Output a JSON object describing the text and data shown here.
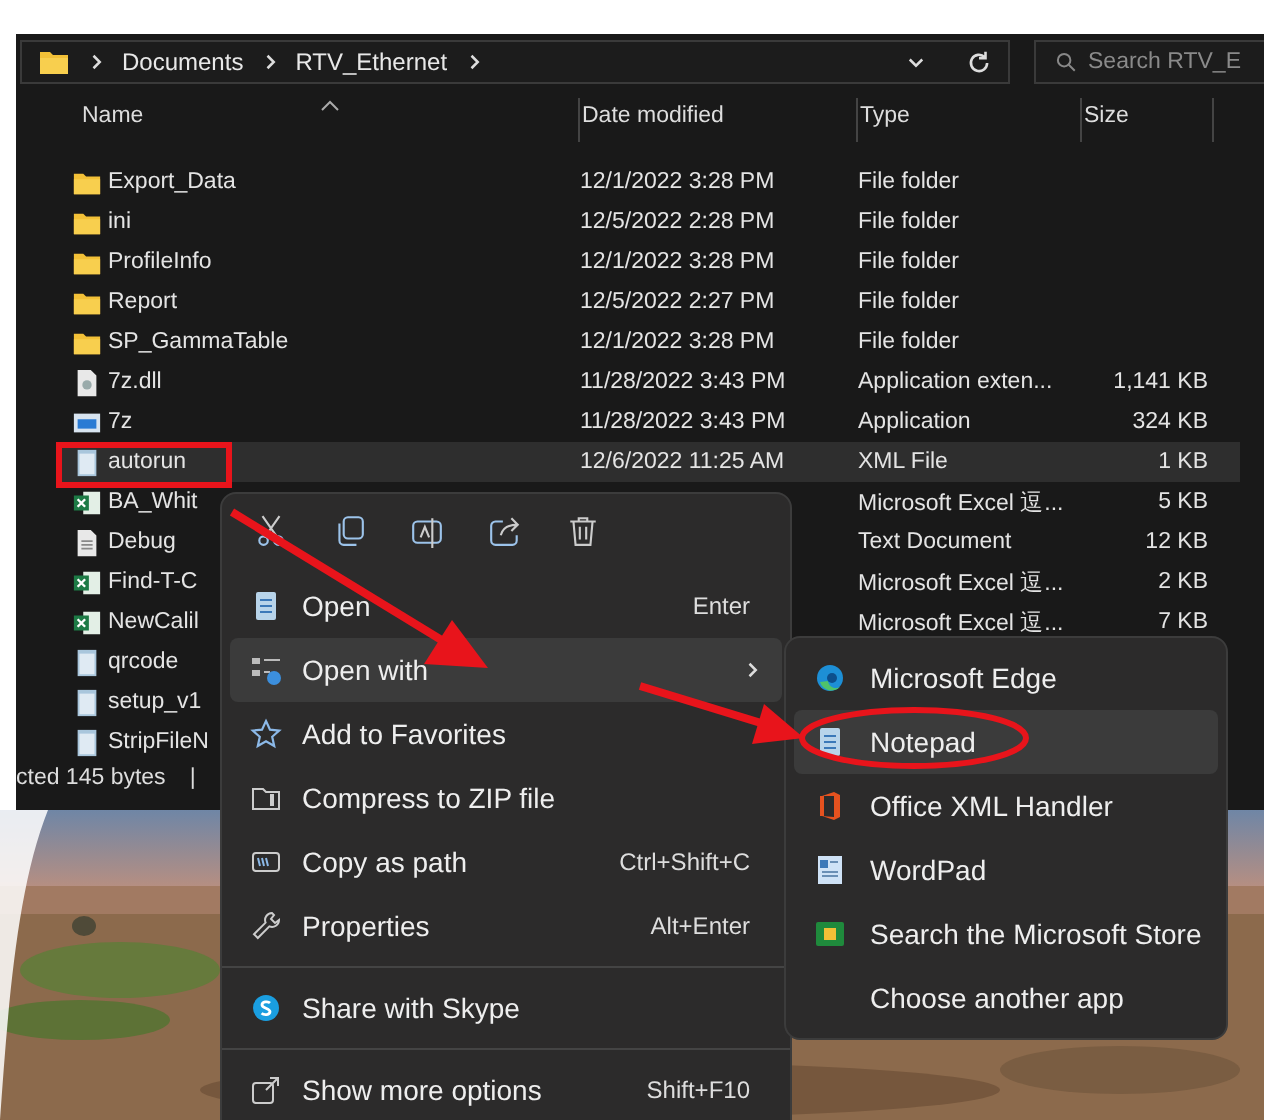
{
  "address_bar": {
    "path": [
      "Documents",
      "RTV_Ethernet"
    ]
  },
  "search": {
    "placeholder": "Search RTV_E"
  },
  "columns": [
    "Name",
    "Date modified",
    "Type",
    "Size"
  ],
  "rows": [
    {
      "kind": "folder",
      "name": "Export_Data",
      "date": "12/1/2022 3:28 PM",
      "type": "File folder",
      "selected": false
    },
    {
      "kind": "folder",
      "name": "ini",
      "date": "12/5/2022 2:28 PM",
      "type": "File folder",
      "selected": false
    },
    {
      "kind": "folder",
      "name": "ProfileInfo",
      "date": "12/1/2022 3:28 PM",
      "type": "File folder",
      "selected": false
    },
    {
      "kind": "folder",
      "name": "Report",
      "date": "12/5/2022 2:27 PM",
      "type": "File folder",
      "selected": false
    },
    {
      "kind": "folder",
      "name": "SP_GammaTable",
      "date": "12/1/2022 3:28 PM",
      "type": "File folder",
      "selected": false
    },
    {
      "kind": "dll",
      "name": "7z.dll",
      "date": "11/28/2022 3:43 PM",
      "type": "Application exten...",
      "size": "1,141 KB",
      "selected": false
    },
    {
      "kind": "app",
      "name": "7z",
      "date": "11/28/2022 3:43 PM",
      "type": "Application",
      "size": "324 KB",
      "selected": false
    },
    {
      "kind": "xml",
      "name": "autorun",
      "date": "12/6/2022 11:25 AM",
      "type": "XML File",
      "size": "1 KB",
      "selected": true
    },
    {
      "kind": "excel",
      "name": "BA_Whit",
      "type": "Microsoft Excel 逗...",
      "size": "5 KB",
      "selected": false
    },
    {
      "kind": "text",
      "name": "Debug",
      "type": "Text Document",
      "size": "12 KB",
      "selected": false
    },
    {
      "kind": "excel",
      "name": "Find-T-C",
      "type": "Microsoft Excel 逗...",
      "size": "2 KB",
      "selected": false
    },
    {
      "kind": "excel",
      "name": "NewCalil",
      "type": "Microsoft Excel 逗...",
      "size": "7 KB",
      "selected": false
    },
    {
      "kind": "xml",
      "name": "qrcode",
      "selected": false
    },
    {
      "kind": "xml",
      "name": "setup_v1",
      "selected": false
    },
    {
      "kind": "xml",
      "name": "StripFileN",
      "selected": false
    }
  ],
  "status_bar": {
    "text": "cted 145 bytes",
    "separator": "|"
  },
  "context_menu": {
    "items": [
      {
        "kind": "item",
        "label": "Open",
        "shortcut": "Enter",
        "selected": false
      },
      {
        "kind": "item",
        "label": "Open with",
        "submenu": true,
        "selected": true
      },
      {
        "kind": "item",
        "label": "Add to Favorites",
        "selected": false
      },
      {
        "kind": "item",
        "label": "Compress to ZIP file",
        "selected": false
      },
      {
        "kind": "item",
        "label": "Copy as path",
        "shortcut": "Ctrl+Shift+C",
        "selected": false
      },
      {
        "kind": "item",
        "label": "Properties",
        "shortcut": "Alt+Enter",
        "selected": false
      },
      {
        "kind": "separator"
      },
      {
        "kind": "item",
        "label": "Share with Skype",
        "selected": false
      },
      {
        "kind": "separator"
      },
      {
        "kind": "item",
        "label": "Show more options",
        "shortcut": "Shift+F10",
        "selected": false
      }
    ]
  },
  "open_with_menu": {
    "items": [
      {
        "label": "Microsoft Edge",
        "selected": false
      },
      {
        "label": "Notepad",
        "selected": true
      },
      {
        "label": "Office XML Handler",
        "selected": false
      },
      {
        "label": "WordPad",
        "selected": false
      },
      {
        "label": "Search the Microsoft Store",
        "selected": false
      },
      {
        "label": "Choose another app",
        "selected": false
      }
    ]
  }
}
